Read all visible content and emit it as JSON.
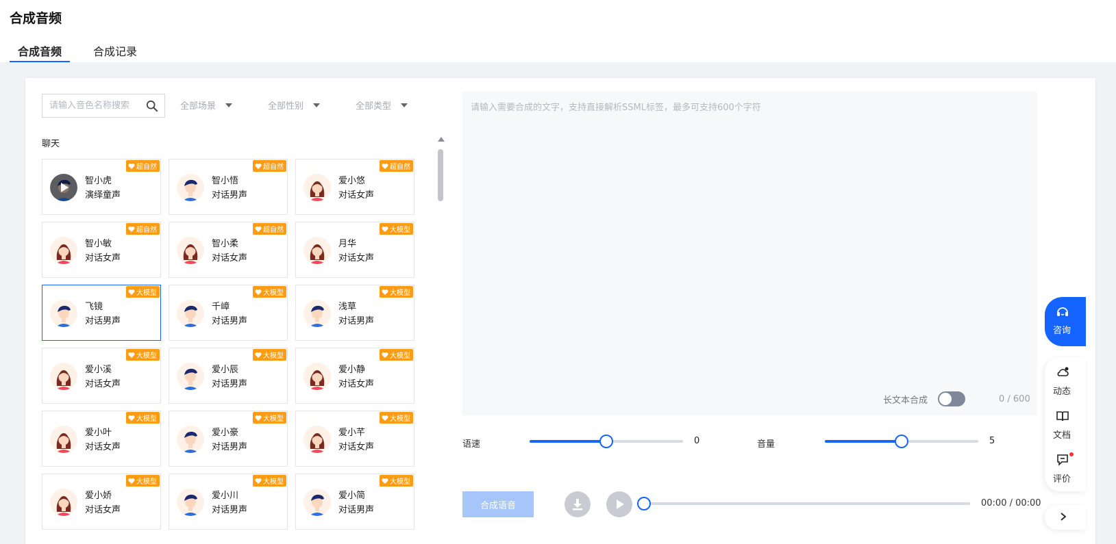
{
  "page": {
    "title": "合成音频"
  },
  "tabs": [
    {
      "label": "合成音频",
      "active": true
    },
    {
      "label": "合成记录",
      "active": false
    }
  ],
  "filters": {
    "search_placeholder": "请输入音色名称搜索",
    "scene": "全部场景",
    "gender": "全部性别",
    "type": "全部类型"
  },
  "section": {
    "label": "聊天"
  },
  "voices": [
    {
      "name": "智小虎",
      "desc": "演绎童声",
      "badge": "超自然",
      "gender": "child",
      "selected": false,
      "playing": true
    },
    {
      "name": "智小悟",
      "desc": "对话男声",
      "badge": "超自然",
      "gender": "male",
      "selected": false
    },
    {
      "name": "爱小悠",
      "desc": "对话女声",
      "badge": "超自然",
      "gender": "female",
      "selected": false
    },
    {
      "name": "智小敏",
      "desc": "对话女声",
      "badge": "超自然",
      "gender": "female",
      "selected": false
    },
    {
      "name": "智小柔",
      "desc": "对话女声",
      "badge": "超自然",
      "gender": "female",
      "selected": false
    },
    {
      "name": "月华",
      "desc": "对话女声",
      "badge": "大模型",
      "gender": "female",
      "selected": false
    },
    {
      "name": "飞镜",
      "desc": "对话男声",
      "badge": "大模型",
      "gender": "male",
      "selected": true
    },
    {
      "name": "千嶂",
      "desc": "对话男声",
      "badge": "大模型",
      "gender": "male",
      "selected": false
    },
    {
      "name": "浅草",
      "desc": "对话男声",
      "badge": "大模型",
      "gender": "male",
      "selected": false
    },
    {
      "name": "爱小溪",
      "desc": "对话女声",
      "badge": "大模型",
      "gender": "female",
      "selected": false
    },
    {
      "name": "爱小辰",
      "desc": "对话男声",
      "badge": "大模型",
      "gender": "male",
      "selected": false
    },
    {
      "name": "爱小静",
      "desc": "对话女声",
      "badge": "大模型",
      "gender": "female",
      "selected": false
    },
    {
      "name": "爱小叶",
      "desc": "对话女声",
      "badge": "大模型",
      "gender": "female",
      "selected": false
    },
    {
      "name": "爱小豪",
      "desc": "对话男声",
      "badge": "大模型",
      "gender": "male",
      "selected": false
    },
    {
      "name": "爱小芊",
      "desc": "对话女声",
      "badge": "大模型",
      "gender": "female",
      "selected": false
    },
    {
      "name": "爱小娇",
      "desc": "对话女声",
      "badge": "大模型",
      "gender": "female",
      "selected": false
    },
    {
      "name": "爱小川",
      "desc": "对话男声",
      "badge": "大模型",
      "gender": "male",
      "selected": false
    },
    {
      "name": "爱小简",
      "desc": "对话男声",
      "badge": "大模型",
      "gender": "male",
      "selected": false
    }
  ],
  "editor": {
    "placeholder": "请输入需要合成的文字，支持直接解析SSML标签，最多可支持600个字符",
    "long_text_label": "长文本合成",
    "long_text_enabled": false,
    "char_count": "0 / 600"
  },
  "params": {
    "speed": {
      "label": "语速",
      "value": "0",
      "fraction": 0.5
    },
    "volume": {
      "label": "音量",
      "value": "5",
      "fraction": 0.5
    }
  },
  "player": {
    "synth_label": "合成语音",
    "time": "00:00 / 00:00",
    "progress": 0
  },
  "side": {
    "consult": "咨询",
    "updates": "动态",
    "docs": "文档",
    "review": "评价"
  },
  "colors": {
    "accent": "#1664ff",
    "badge": "#ff9c16",
    "synth_button_disabled": "#a6c6fa"
  }
}
